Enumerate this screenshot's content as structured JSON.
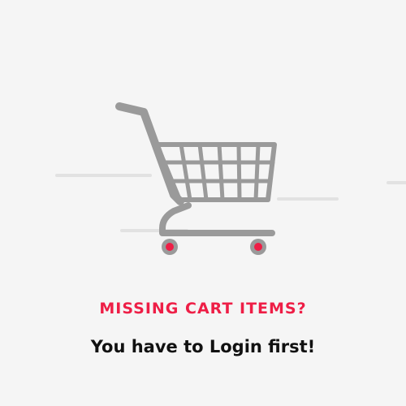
{
  "empty_state": {
    "illustration_icon": "shopping-cart-icon",
    "headline": "MISSING CART ITEMS?",
    "message": "You have to Login first!"
  },
  "colors": {
    "background": "#f5f5f5",
    "accent": "#ee1e46",
    "cart": "#9a9a9a",
    "speed_lines": "#e2e2e2",
    "text": "#111111"
  }
}
